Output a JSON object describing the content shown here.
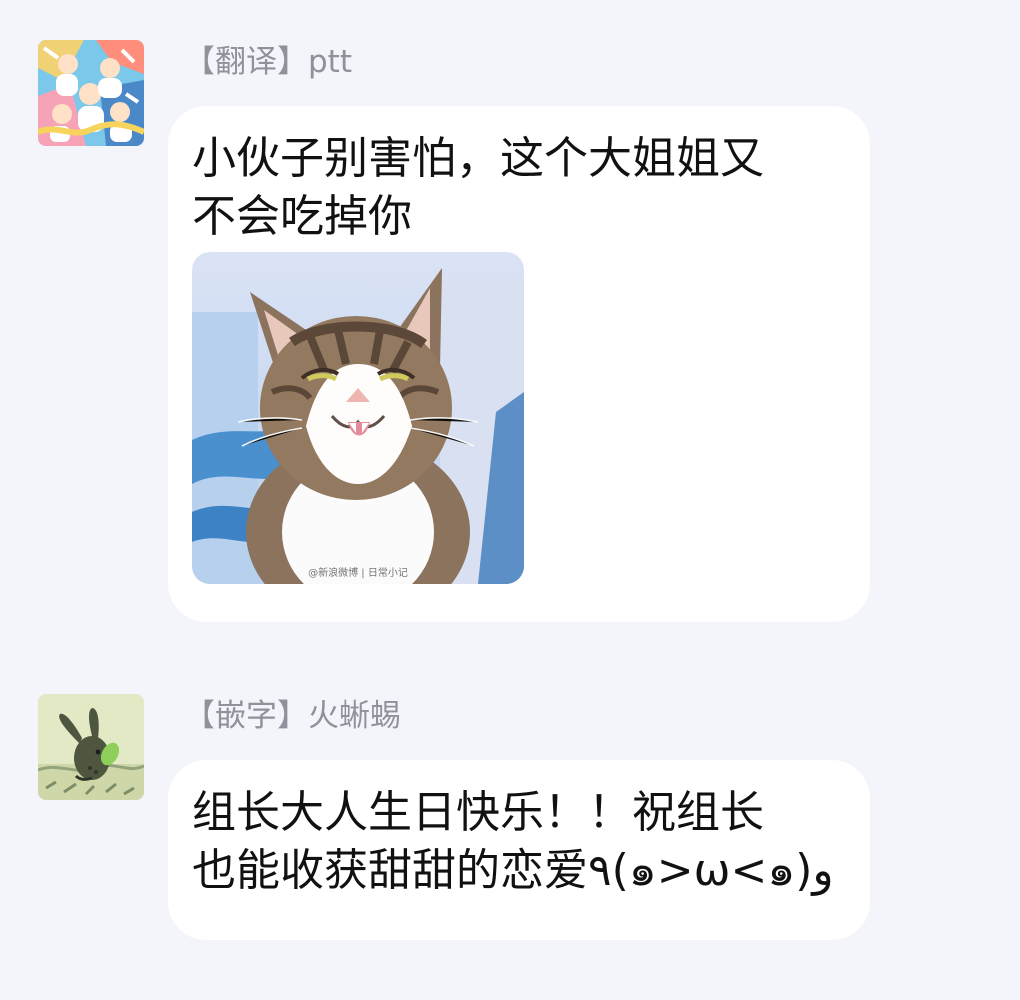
{
  "messages": [
    {
      "sender_tag": "【翻译】",
      "sender_name": "ptt",
      "text": "小伙子别害怕，这个大姐姐又\n不会吃掉你",
      "avatar_icon": "anime-group-avatar",
      "sticker_icon": "cat-smirk-sticker",
      "sticker_watermark": "@新浪微博 | 日常小记"
    },
    {
      "sender_tag": "【嵌字】",
      "sender_name": "火蜥蜴",
      "text": "组长大人生日快乐！！祝组长\n也能收获甜甜的恋爱٩(๑>ω<๑)و",
      "avatar_icon": "rabbit-avatar"
    }
  ],
  "colors": {
    "background": "#f4f5fa",
    "bubble": "#ffffff",
    "sender": "#8f929b",
    "message_text": "#111111"
  }
}
